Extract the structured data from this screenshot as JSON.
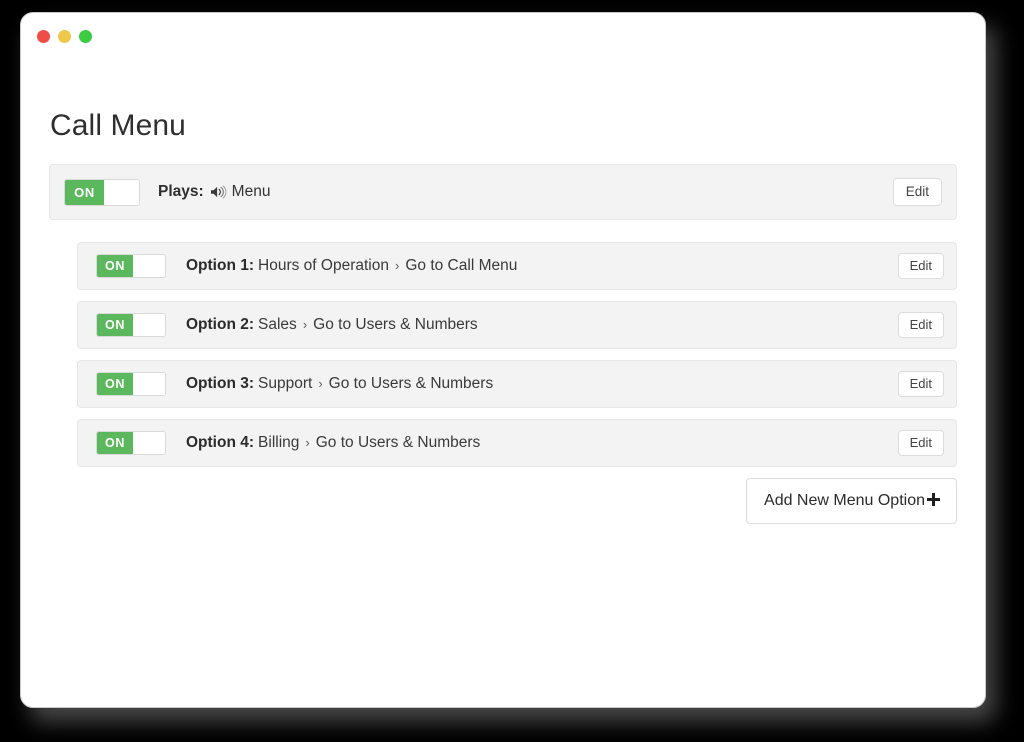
{
  "window": {
    "traffic_lights": [
      {
        "name": "close",
        "color": "#ef4e46"
      },
      {
        "name": "minimize",
        "color": "#eec84a"
      },
      {
        "name": "maximize",
        "color": "#3ccb42"
      }
    ]
  },
  "page": {
    "title": "Call Menu"
  },
  "plays_card": {
    "toggle_state": "ON",
    "label": "Plays:",
    "icon": "speaker-volume-icon",
    "value": "Menu",
    "edit_label": "Edit"
  },
  "options": [
    {
      "toggle_state": "ON",
      "label": "Option 1:",
      "name": "Hours of Operation",
      "separator": "›",
      "destination": "Go to Call Menu",
      "edit_label": "Edit"
    },
    {
      "toggle_state": "ON",
      "label": "Option 2:",
      "name": "Sales",
      "separator": "›",
      "destination": "Go to Users & Numbers",
      "edit_label": "Edit"
    },
    {
      "toggle_state": "ON",
      "label": "Option 3:",
      "name": "Support",
      "separator": "›",
      "destination": "Go to Users & Numbers",
      "edit_label": "Edit"
    },
    {
      "toggle_state": "ON",
      "label": "Option 4:",
      "name": "Billing",
      "separator": "›",
      "destination": "Go to Users & Numbers",
      "edit_label": "Edit"
    }
  ],
  "add_button": {
    "label": "Add New Menu Option",
    "icon": "plus-icon",
    "glyph": "➕"
  },
  "colors": {
    "toggle_on": "#5cb85c",
    "row_background": "#f3f3f3",
    "row_border": "#e6e6e6",
    "page_background": "#ffffff"
  }
}
